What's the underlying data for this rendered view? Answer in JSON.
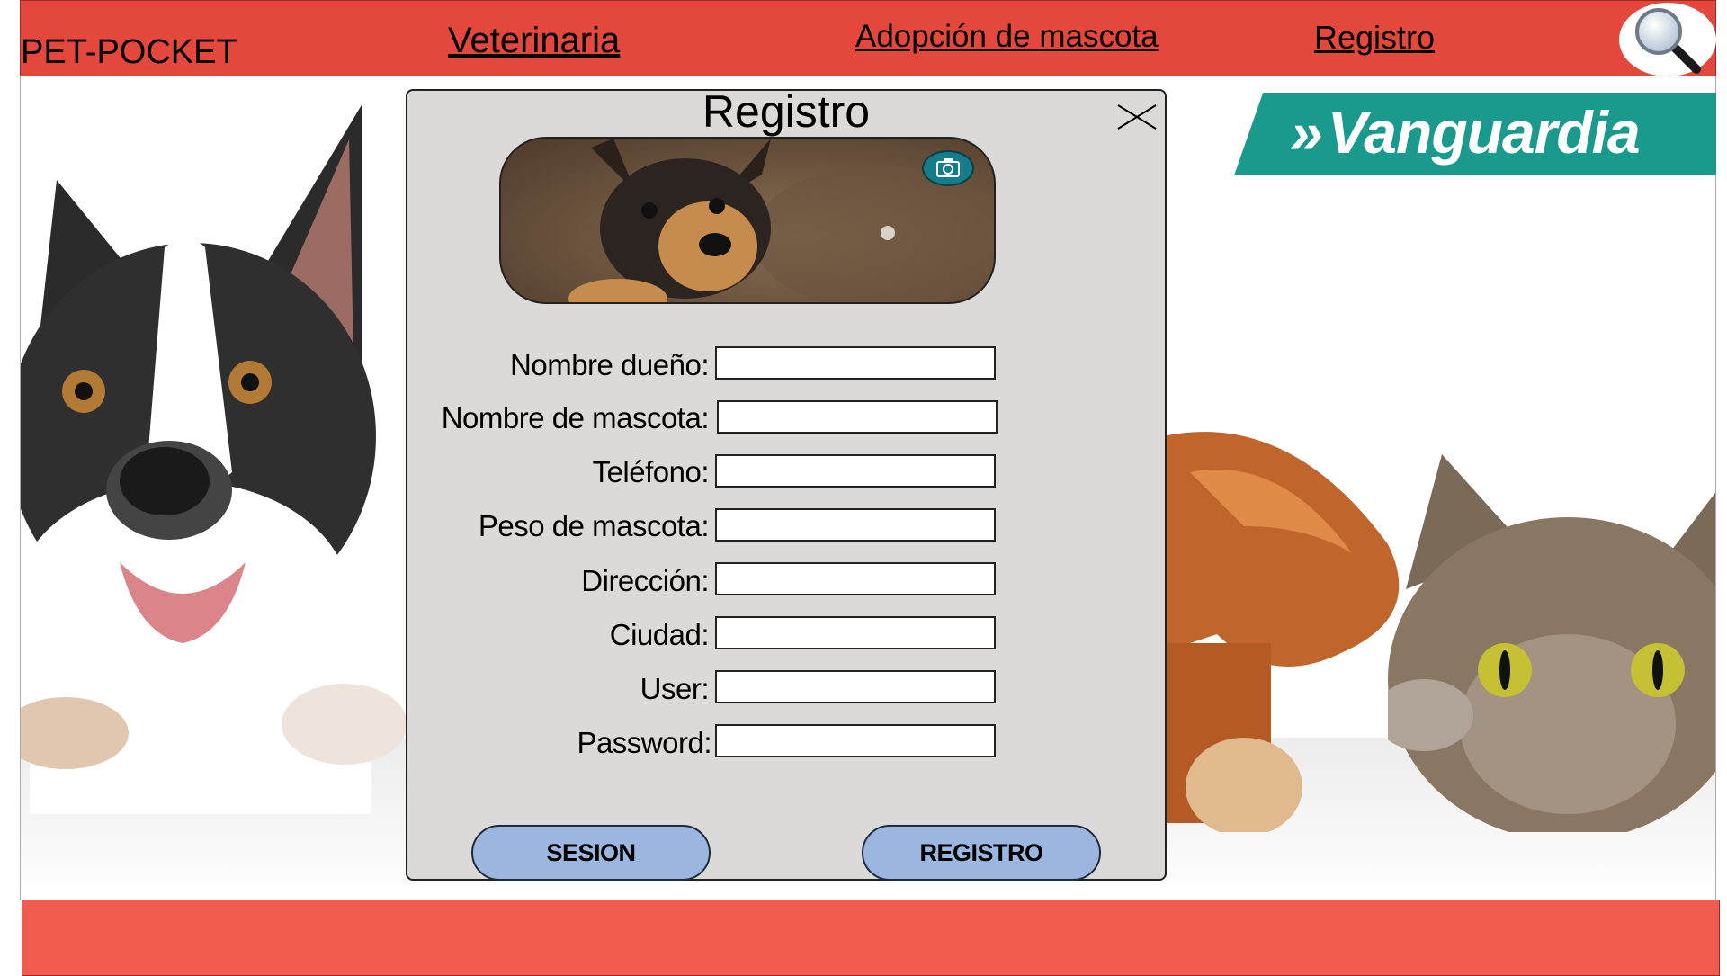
{
  "header": {
    "brand": "PET-POCKET",
    "nav": [
      {
        "label": "Veterinaria "
      },
      {
        "label": "Adopción de mascota "
      },
      {
        "label": "Registro"
      }
    ],
    "search_icon": "magnifier-icon"
  },
  "ad": {
    "arrows": "»",
    "text": "Vanguardia",
    "color": "#1a9a8c"
  },
  "modal": {
    "title": "Registro",
    "close_icon": "close-icon",
    "camera_icon": "camera-icon",
    "fields": [
      {
        "label": "Nombre dueño:",
        "value": ""
      },
      {
        "label": "Nombre de mascota:",
        "value": ""
      },
      {
        "label": "Teléfono:",
        "value": ""
      },
      {
        "label": "Peso de mascota:",
        "value": ""
      },
      {
        "label": "Dirección:",
        "value": ""
      },
      {
        "label": "Ciudad:",
        "value": ""
      },
      {
        "label": "User:",
        "value": ""
      },
      {
        "label": "Password:",
        "value": ""
      }
    ],
    "buttons": {
      "session": "SESION",
      "register": "REGISTRO"
    }
  },
  "colors": {
    "header": "#e4473b",
    "footer": "#f25c50",
    "modal_bg": "#dcdad9",
    "button_bg": "#9bb7e0"
  }
}
